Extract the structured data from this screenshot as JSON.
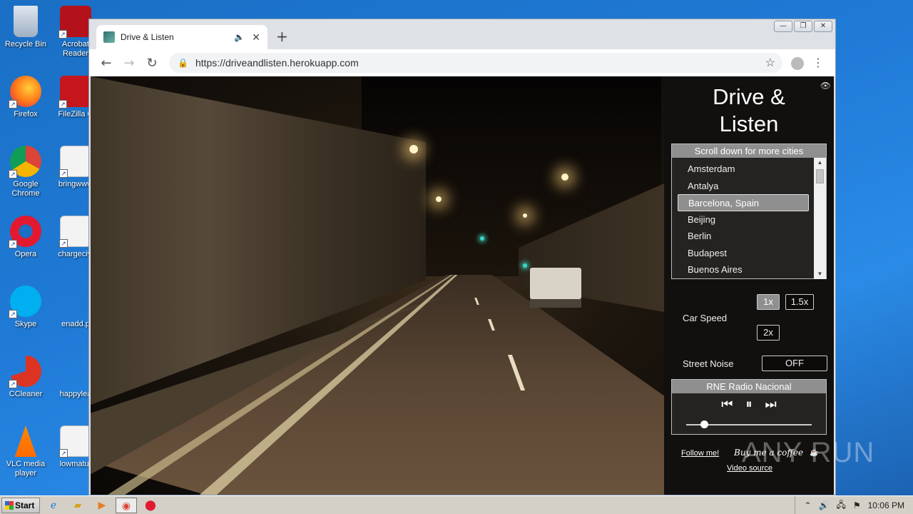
{
  "desktop": {
    "icons": [
      {
        "label": "Recycle Bin"
      },
      {
        "label": "Acrobat Reader"
      },
      {
        "label": "Firefox"
      },
      {
        "label": "FileZilla C"
      },
      {
        "label": "Google Chrome"
      },
      {
        "label": "bringwww"
      },
      {
        "label": "Opera"
      },
      {
        "label": "chargecivi"
      },
      {
        "label": "Skype"
      },
      {
        "label": "enadd.p"
      },
      {
        "label": "CCleaner"
      },
      {
        "label": "happylea"
      },
      {
        "label": "VLC media player"
      },
      {
        "label": "lowmatur"
      }
    ]
  },
  "browser": {
    "tab_title": "Drive & Listen",
    "url": "https://driveandlisten.herokuapp.com",
    "window_controls": {
      "minimize": "—",
      "restore": "❐",
      "close": "✕"
    }
  },
  "page": {
    "site_title_line1": "Drive &",
    "site_title_line2": "Listen",
    "city_header": "Scroll down for more cities",
    "cities": [
      "Amsterdam",
      "Antalya",
      "Barcelona, Spain",
      "Beijing",
      "Berlin",
      "Budapest",
      "Buenos Aires"
    ],
    "selected_city": "Barcelona, Spain",
    "car_speed_label": "Car Speed",
    "speed_options": [
      "1x",
      "1.5x",
      "2x"
    ],
    "selected_speed": "1x",
    "street_noise_label": "Street Noise",
    "street_noise_value": "OFF",
    "radio_station": "RNE Radio Nacional",
    "volume_level_fraction": 0.14,
    "follow_link": "Follow me!",
    "coffee_text": "Buy me a coffee",
    "video_source_link": "Video source"
  },
  "watermark": "ANY RUN",
  "taskbar": {
    "start_label": "Start",
    "clock": "10:06 PM"
  }
}
